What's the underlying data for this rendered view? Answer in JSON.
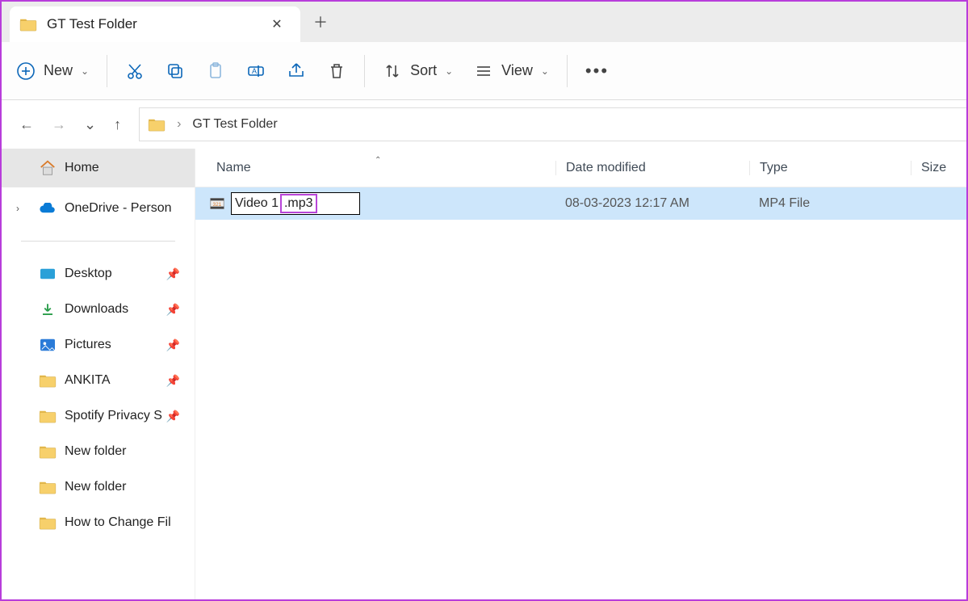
{
  "tab": {
    "title": "GT Test Folder"
  },
  "toolbar": {
    "new_label": "New",
    "sort_label": "Sort",
    "view_label": "View"
  },
  "breadcrumb": {
    "folder": "GT Test Folder"
  },
  "columns": {
    "name": "Name",
    "date": "Date modified",
    "type": "Type",
    "size": "Size"
  },
  "file": {
    "rename_value": "Video 1.mp3",
    "rename_base": "Video 1",
    "rename_ext": ".mp3",
    "date": "08-03-2023 12:17 AM",
    "type": "MP4 File",
    "size": ""
  },
  "sidebar": {
    "home": "Home",
    "onedrive": "OneDrive - Person",
    "items": [
      {
        "label": "Desktop",
        "pinned": true,
        "icon": "desktop"
      },
      {
        "label": "Downloads",
        "pinned": true,
        "icon": "download"
      },
      {
        "label": "Pictures",
        "pinned": true,
        "icon": "pictures"
      },
      {
        "label": "ANKITA",
        "pinned": true,
        "icon": "folder"
      },
      {
        "label": "Spotify Privacy S",
        "pinned": true,
        "icon": "folder"
      },
      {
        "label": "New folder",
        "pinned": false,
        "icon": "folder"
      },
      {
        "label": "New folder",
        "pinned": false,
        "icon": "folder"
      },
      {
        "label": "How to Change Fil",
        "pinned": false,
        "icon": "folder"
      }
    ]
  }
}
